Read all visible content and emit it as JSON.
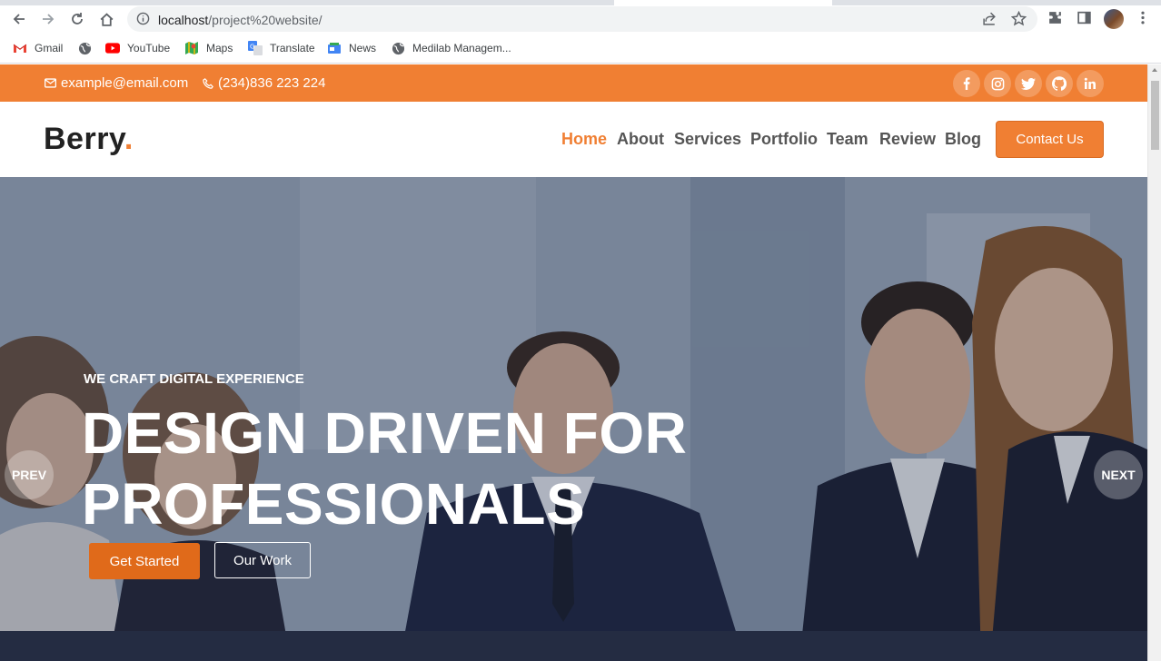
{
  "browser": {
    "url_host": "localhost",
    "url_path": "/project%20website/",
    "bookmarks": [
      {
        "label": "Gmail",
        "icon": "gmail-icon"
      },
      {
        "label": "",
        "icon": "globe-icon"
      },
      {
        "label": "YouTube",
        "icon": "youtube-icon"
      },
      {
        "label": "Maps",
        "icon": "maps-icon"
      },
      {
        "label": "Translate",
        "icon": "translate-icon"
      },
      {
        "label": "News",
        "icon": "news-icon"
      },
      {
        "label": "Medilab Managem...",
        "icon": "globe-icon"
      }
    ]
  },
  "topbar": {
    "email": "example@email.com",
    "phone": "(234)836 223 224",
    "socials": [
      "facebook-icon",
      "instagram-icon",
      "twitter-icon",
      "github-icon",
      "linkedin-icon"
    ]
  },
  "header": {
    "logo_text": "Berry",
    "logo_dot": ".",
    "menu": [
      "Home",
      "About",
      "Services",
      "Portfolio",
      "Team",
      "Review",
      "Blog"
    ],
    "active_menu": "Home",
    "cta_label": "Contact Us"
  },
  "hero": {
    "eyebrow": "WE CRAFT DIGITAL EXPERIENCE",
    "headline_line1": "DESIGN DRIVEN FOR",
    "headline_line2": "PROFESSIONALS",
    "primary_button": "Get Started",
    "secondary_button": "Our Work",
    "prev_label": "PREV",
    "next_label": "NEXT"
  },
  "colors": {
    "accent": "#f07f33",
    "accent_dark": "#e06a1a",
    "text_dark": "#222222"
  }
}
